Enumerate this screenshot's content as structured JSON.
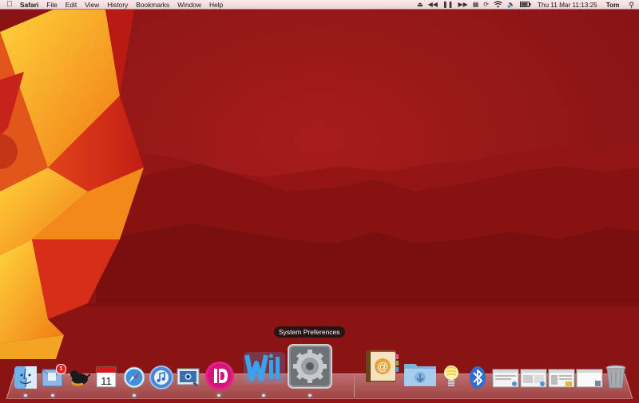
{
  "menubar": {
    "app_name": "Safari",
    "menus": [
      "File",
      "Edit",
      "View",
      "History",
      "Bookmarks",
      "Window",
      "Help"
    ],
    "status": {
      "clock": "Thu 11 Mar  11:13:25",
      "user": "Tom"
    },
    "status_icons": [
      "spotlight-icon"
    ]
  },
  "dock": {
    "tooltip": "System Preferences",
    "items": [
      {
        "name": "finder",
        "icon": "finder-icon"
      },
      {
        "name": "mail",
        "icon": "mail-icon",
        "badge": "1"
      },
      {
        "name": "twitter-bird",
        "icon": "bird-icon"
      },
      {
        "name": "ical",
        "icon": "calendar-icon",
        "date": "11"
      },
      {
        "name": "safari",
        "icon": "compass-icon"
      },
      {
        "name": "itunes",
        "icon": "itunes-icon"
      },
      {
        "name": "preview",
        "icon": "preview-icon"
      },
      {
        "name": "app-i",
        "icon": "i-logo-icon"
      },
      {
        "name": "word",
        "icon": "word-icon"
      },
      {
        "name": "system-preferences",
        "icon": "gear-icon"
      },
      {
        "name": "address-book",
        "icon": "address-book-icon"
      },
      {
        "name": "downloads",
        "icon": "downloads-folder-icon"
      },
      {
        "name": "lightbulb",
        "icon": "lightbulb-icon"
      },
      {
        "name": "bluetooth",
        "icon": "bluetooth-icon"
      },
      {
        "name": "window-1",
        "icon": "window-thumbnail-icon"
      },
      {
        "name": "window-2",
        "icon": "window-thumbnail-icon"
      },
      {
        "name": "window-3",
        "icon": "window-thumbnail-icon"
      },
      {
        "name": "window-4",
        "icon": "window-thumbnail-icon"
      },
      {
        "name": "trash",
        "icon": "trash-icon"
      }
    ]
  },
  "colors": {
    "wallpaper": "#8e1616",
    "mountains": "#7a1010",
    "origami_orange": "#f29a1c",
    "origami_red": "#d32a1a"
  }
}
